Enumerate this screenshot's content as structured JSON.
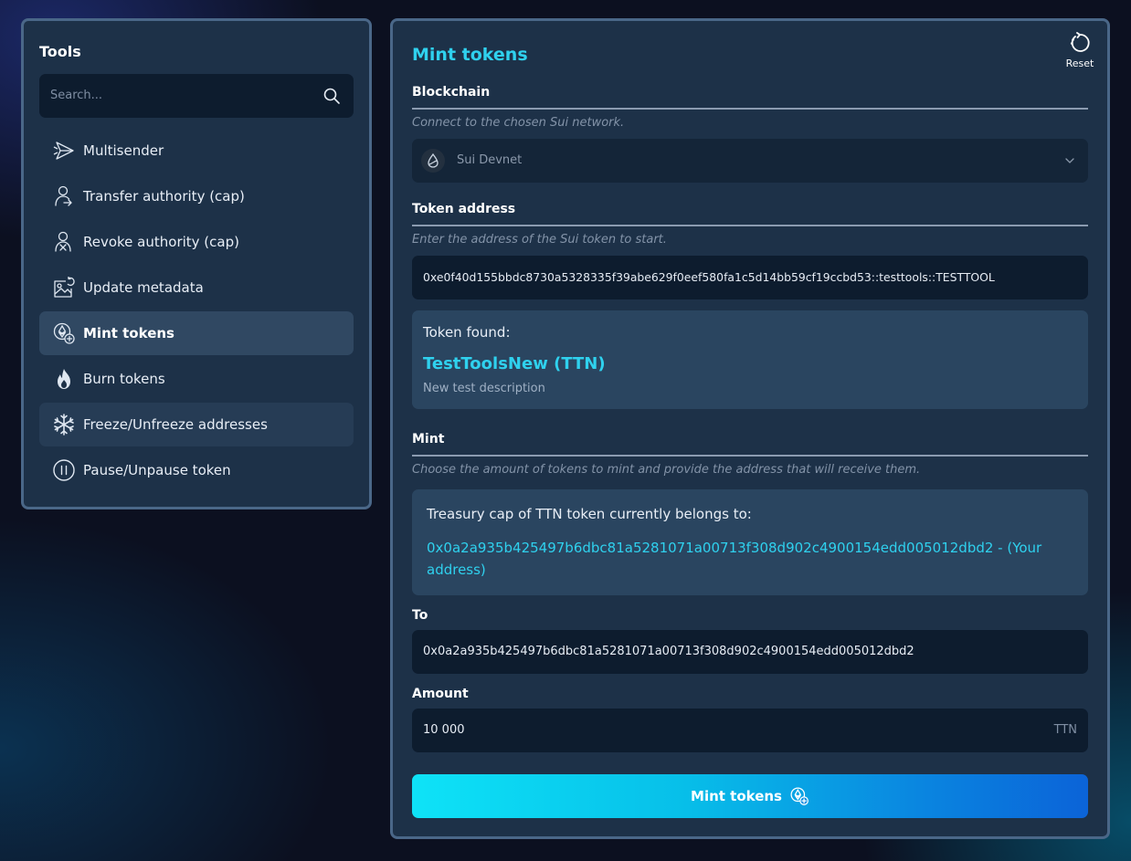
{
  "sidebar": {
    "title": "Tools",
    "search": {
      "placeholder": "Search..."
    },
    "items": [
      {
        "label": "Multisender",
        "icon": "send-icon"
      },
      {
        "label": "Transfer authority (cap)",
        "icon": "user-transfer-icon"
      },
      {
        "label": "Revoke authority (cap)",
        "icon": "user-revoke-icon"
      },
      {
        "label": "Update metadata",
        "icon": "image-refresh-icon"
      },
      {
        "label": "Mint tokens",
        "icon": "token-plus-icon",
        "active": true
      },
      {
        "label": "Burn tokens",
        "icon": "flame-icon"
      },
      {
        "label": "Freeze/Unfreeze addresses",
        "icon": "snowflake-icon"
      },
      {
        "label": "Pause/Unpause token",
        "icon": "pause-circle-icon"
      }
    ]
  },
  "main": {
    "title": "Mint tokens",
    "reset_label": "Reset",
    "blockchain": {
      "title": "Blockchain",
      "hint": "Connect to the chosen Sui network.",
      "selected": "Sui Devnet"
    },
    "token_address": {
      "title": "Token address",
      "hint": "Enter the address of the Sui token to start.",
      "value": "0xe0f40d155bbdc8730a5328335f39abe629f0eef580fa1c5d14bb59cf19ccbd53::testtools::TESTTOOL"
    },
    "token_found": {
      "label": "Token found:",
      "name": "TestToolsNew (TTN)",
      "description": "New test description"
    },
    "mint": {
      "title": "Mint",
      "hint": "Choose the amount of tokens to mint and provide the address that will receive them.",
      "treasury_label": "Treasury cap of TTN token currently belongs to:",
      "treasury_address": "0x0a2a935b425497b6dbc81a5281071a00713f308d902c4900154edd005012dbd2 - (Your address)",
      "to_label": "To",
      "to_value": "0x0a2a935b425497b6dbc81a5281071a00713f308d902c4900154edd005012dbd2",
      "amount_label": "Amount",
      "amount_value": "10 000",
      "amount_suffix": "TTN",
      "button_label": "Mint tokens"
    }
  },
  "colors": {
    "accent": "#2fd1ee",
    "panel": "#1d3148",
    "panel_border": "#4a6788",
    "field": "#0d1c2e"
  }
}
